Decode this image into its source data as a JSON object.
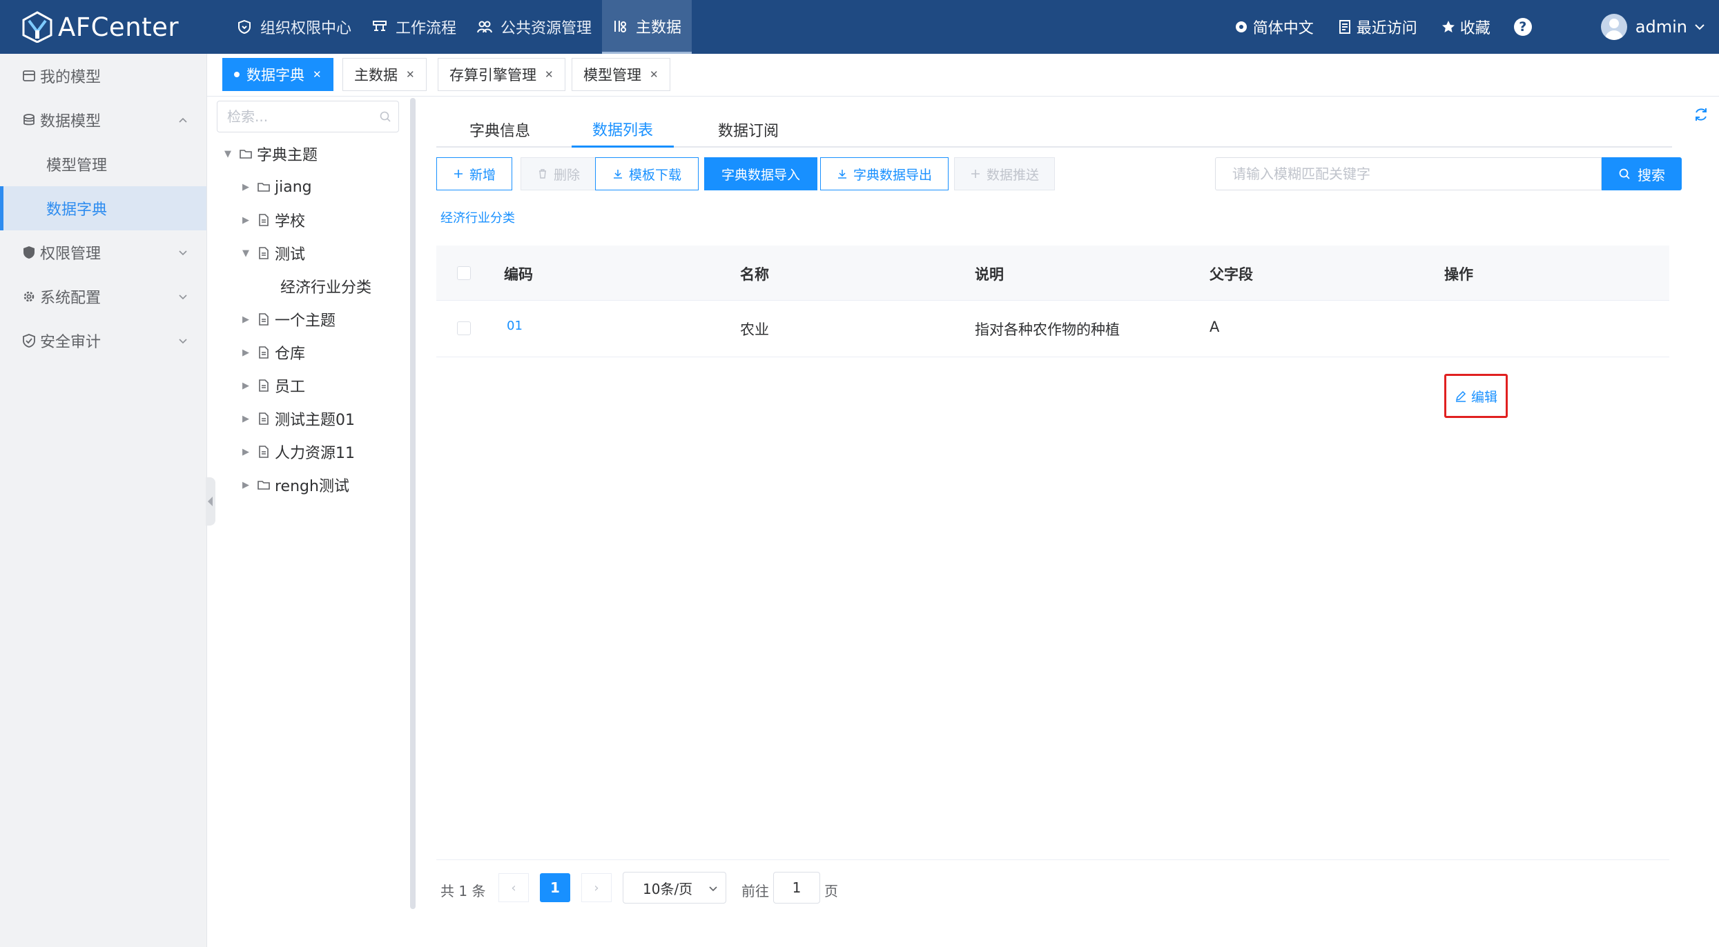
{
  "app": {
    "name": "AFCenter"
  },
  "topnav": [
    {
      "label": "组织权限中心",
      "icon": "shield-heart-icon",
      "active": false
    },
    {
      "label": "工作流程",
      "icon": "flow-icon",
      "active": false
    },
    {
      "label": "公共资源管理",
      "icon": "people-icon",
      "active": false
    },
    {
      "label": "主数据",
      "icon": "data-icon",
      "active": true
    }
  ],
  "topright": {
    "language": "简体中文",
    "recent": "最近访问",
    "favorites": "收藏",
    "help": "?",
    "user": "admin"
  },
  "sidebar": {
    "items": [
      {
        "label": "我的模型",
        "icon": "model-icon"
      },
      {
        "label": "数据模型",
        "icon": "database-icon",
        "expanded": true
      },
      {
        "label": "权限管理",
        "icon": "shield-icon"
      },
      {
        "label": "系统配置",
        "icon": "gear-icon"
      },
      {
        "label": "安全审计",
        "icon": "audit-icon"
      }
    ],
    "subitems": [
      {
        "label": "模型管理",
        "active": false
      },
      {
        "label": "数据字典",
        "active": true
      }
    ]
  },
  "tags": [
    {
      "label": "数据字典",
      "active": true
    },
    {
      "label": "主数据",
      "active": false
    },
    {
      "label": "存算引擎管理",
      "active": false
    },
    {
      "label": "模型管理",
      "active": false
    }
  ],
  "tree": {
    "search_placeholder": "检索...",
    "root": "字典主题",
    "nodes": [
      {
        "label": "jiang",
        "type": "folder"
      },
      {
        "label": "学校",
        "type": "doc"
      },
      {
        "label": "测试",
        "type": "doc",
        "expanded": true
      },
      {
        "label": "经济行业分类",
        "type": "leaf"
      },
      {
        "label": "一个主题",
        "type": "doc"
      },
      {
        "label": "仓库",
        "type": "doc"
      },
      {
        "label": "员工",
        "type": "doc"
      },
      {
        "label": "测试主题01",
        "type": "doc"
      },
      {
        "label": "人力资源11",
        "type": "doc"
      },
      {
        "label": "rengh测试",
        "type": "folder"
      }
    ]
  },
  "subtabs": [
    {
      "label": "字典信息",
      "active": false
    },
    {
      "label": "数据列表",
      "active": true
    },
    {
      "label": "数据订阅",
      "active": false
    }
  ],
  "toolbar": {
    "add": "新增",
    "delete": "删除",
    "template_download": "模板下载",
    "import": "字典数据导入",
    "export": "字典数据导出",
    "push": "数据推送",
    "search_placeholder": "请输入模糊匹配关键字",
    "search": "搜索"
  },
  "breadcrumb": "经济行业分类",
  "table": {
    "columns": [
      "编码",
      "名称",
      "说明",
      "父字段",
      "操作"
    ],
    "rows": [
      {
        "code": "01",
        "name": "农业",
        "desc": "指对各种农作物的种植",
        "parent": "A",
        "action": "编辑"
      }
    ]
  },
  "pagination": {
    "total": "共 1 条",
    "current": "1",
    "page_size": "10条/页",
    "goto_label": "前往",
    "goto_value": "1",
    "page_label": "页"
  },
  "colors": {
    "header": "#1f4a82",
    "accent": "#1890ff",
    "highlight": "#e02020"
  }
}
